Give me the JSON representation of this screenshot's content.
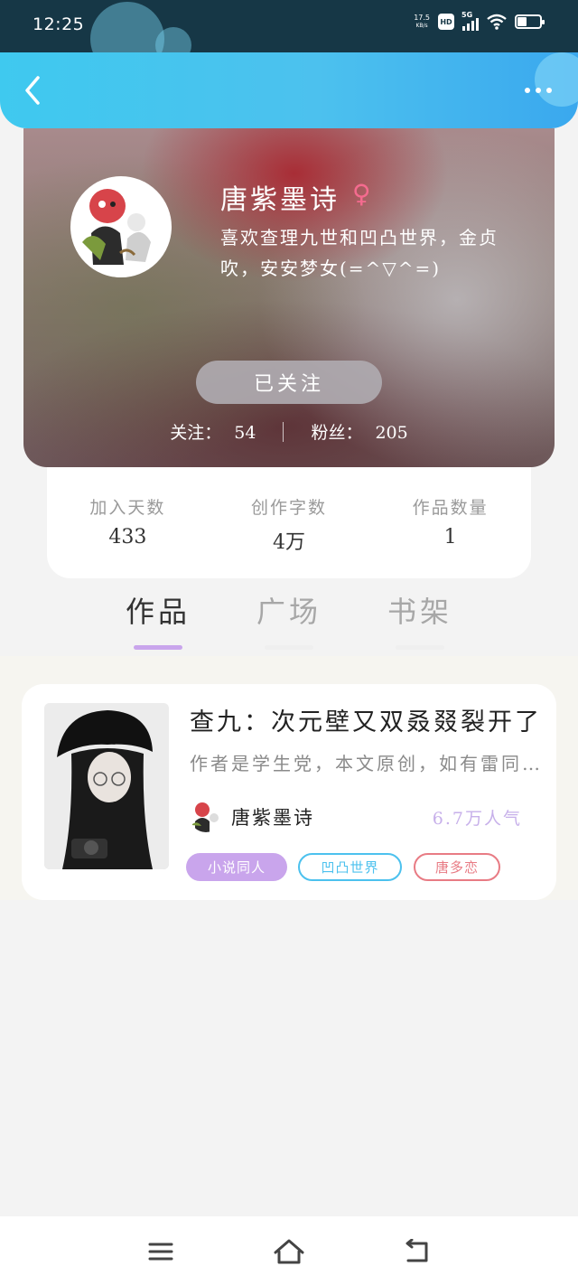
{
  "status_bar": {
    "time": "12:25",
    "net_speed": "17.5",
    "net_unit": "KB/s",
    "hd": "HD",
    "network": "5G"
  },
  "header": {
    "back_icon": "chevron-left-icon",
    "more_icon": "more-dots-icon"
  },
  "profile": {
    "username": "唐紫墨诗",
    "gender_symbol": "♀",
    "bio": "喜欢查理九世和凹凸世界，金贞吹，安安梦女(=^▽^=)",
    "follow_button": "已关注",
    "following_label": "关注：",
    "following_count": "54",
    "followers_label": "粉丝：",
    "followers_count": "205"
  },
  "stats": [
    {
      "label": "加入天数",
      "value": "433"
    },
    {
      "label": "创作字数",
      "value": "4万"
    },
    {
      "label": "作品数量",
      "value": "1"
    }
  ],
  "tabs": [
    {
      "label": "作品",
      "active": true
    },
    {
      "label": "广场",
      "active": false
    },
    {
      "label": "书架",
      "active": false
    }
  ],
  "work": {
    "title": "查九：次元壁又双叒叕裂开了",
    "description": "作者是学生党，本文原创，如有雷同纯属巧合",
    "author": "唐紫墨诗",
    "popularity": "6.7万人气",
    "tags": [
      "小说同人",
      "凹凸世界",
      "唐多恋"
    ]
  },
  "colors": {
    "header_accent": "#4cc1ee",
    "tab_active_underline": "#c9a5ec",
    "tag_purple": "#c9a5ec",
    "tag_blue": "#4cc1ee",
    "tag_red": "#e87b84",
    "gender_pink": "#f56b8f"
  },
  "bottom_nav": {
    "menu_icon": "menu-icon",
    "home_icon": "home-icon",
    "back_icon": "back-arrow-icon"
  }
}
